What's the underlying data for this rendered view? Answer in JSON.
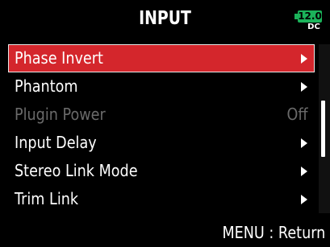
{
  "header": {
    "title": "INPUT",
    "battery": {
      "level_label": "12.0",
      "source": "DC",
      "color": "#1bb35a",
      "icon": "battery-icon"
    }
  },
  "menu": {
    "items": [
      {
        "label": "Phase Invert",
        "value": "",
        "selected": true,
        "disabled": false,
        "has_arrow": true
      },
      {
        "label": "Phantom",
        "value": "",
        "selected": false,
        "disabled": false,
        "has_arrow": true
      },
      {
        "label": "Plugin Power",
        "value": "Off",
        "selected": false,
        "disabled": true,
        "has_arrow": false
      },
      {
        "label": "Input Delay",
        "value": "",
        "selected": false,
        "disabled": false,
        "has_arrow": true
      },
      {
        "label": "Stereo Link Mode",
        "value": "",
        "selected": false,
        "disabled": false,
        "has_arrow": true
      },
      {
        "label": "Trim Link",
        "value": "",
        "selected": false,
        "disabled": false,
        "has_arrow": true
      }
    ],
    "selected_color": "#d4262c",
    "disabled_color": "#6a6a6a"
  },
  "footer": {
    "hint": "MENU : Return"
  }
}
